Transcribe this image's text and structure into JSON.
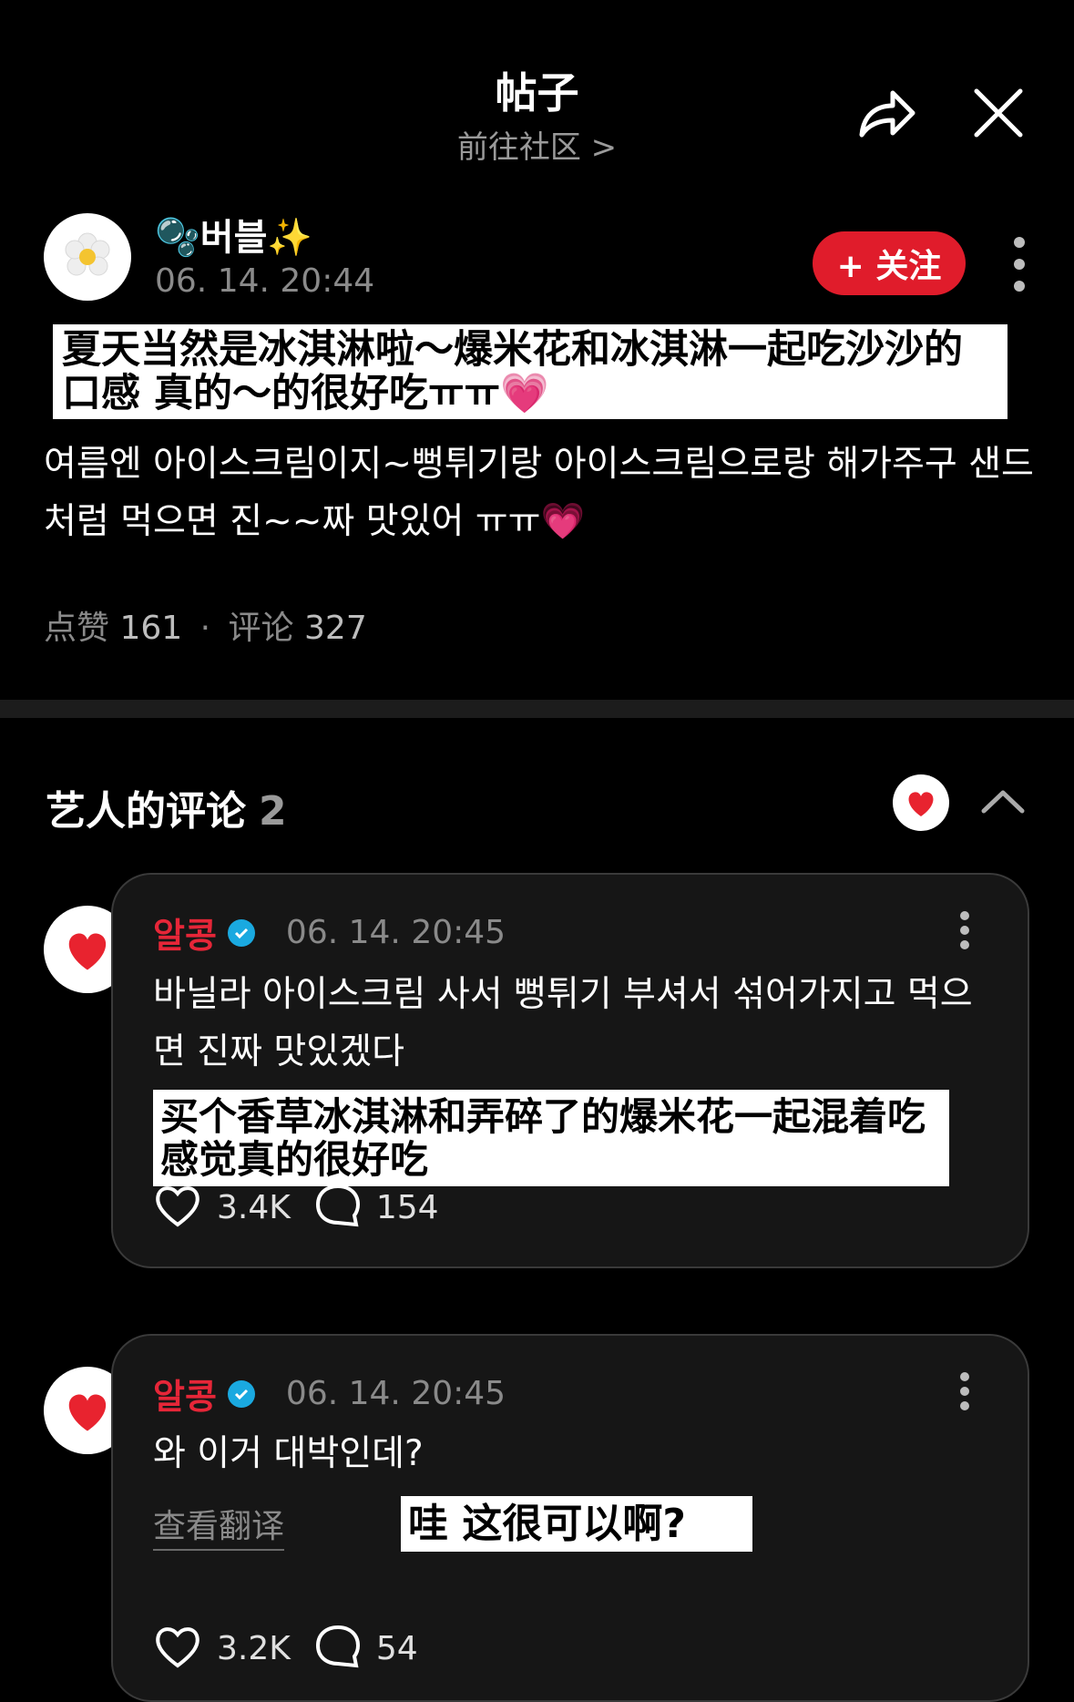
{
  "header": {
    "title": "帖子",
    "subtitle": "前往社区 >"
  },
  "post": {
    "author": "🫧버블✨",
    "time": "06. 14. 20:44",
    "follow_label": "+ 关注",
    "translation_box": "夏天当然是冰淇淋啦～爆米花和冰淇淋一起吃沙沙的口感 真的～的很好吃ㅠㅠ💗",
    "original_text": "여름엔 아이스크림이지~뻥튀기랑 아이스크림으로랑 해가주구 샌드처럼 먹으면 진~~짜 맛있어 ㅠㅠ💗",
    "likes_label": "点赞",
    "likes": "161",
    "comments_label": "评论",
    "comments": "327"
  },
  "artist_section": {
    "title": "艺人的评论",
    "count": "2"
  },
  "comments": [
    {
      "name": "알콩",
      "time": "06. 14. 20:45",
      "text": "바닐라 아이스크림 사서 뻥튀기 부셔서 섞어가지고 먹으면 진짜 맛있겠다",
      "translation_box": "买个香草冰淇淋和弄碎了的爆米花一起混着吃 感觉真的很好吃",
      "likes": "3.4K",
      "replies": "154"
    },
    {
      "name": "알콩",
      "time": "06. 14. 20:45",
      "text": "와 이거 대박인데?",
      "see_translation": "查看翻译",
      "translation_box": "哇 这很可以啊?",
      "likes": "3.2K",
      "replies": "54"
    }
  ],
  "colors": {
    "accent_red": "#e01c2b",
    "verified_blue": "#1aa9e0",
    "background": "#000000"
  }
}
